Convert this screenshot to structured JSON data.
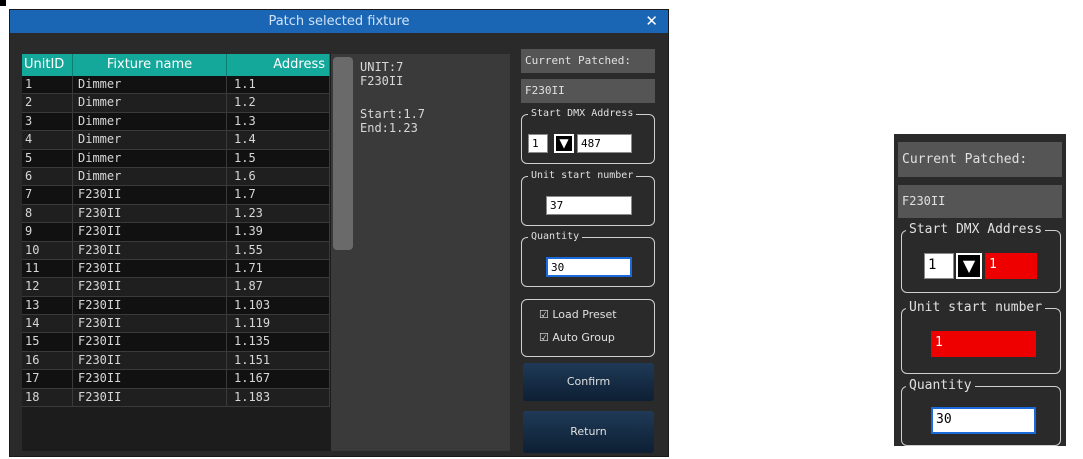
{
  "dialog": {
    "title": "Patch selected fixture",
    "close": "✕"
  },
  "table": {
    "headers": [
      "UnitID",
      "Fixture name",
      "Address"
    ],
    "rows": [
      [
        "1",
        "Dimmer",
        "1.1"
      ],
      [
        "2",
        "Dimmer",
        "1.2"
      ],
      [
        "3",
        "Dimmer",
        "1.3"
      ],
      [
        "4",
        "Dimmer",
        "1.4"
      ],
      [
        "5",
        "Dimmer",
        "1.5"
      ],
      [
        "6",
        "Dimmer",
        "1.6"
      ],
      [
        "7",
        "F230II",
        "1.7"
      ],
      [
        "8",
        "F230II",
        "1.23"
      ],
      [
        "9",
        "F230II",
        "1.39"
      ],
      [
        "10",
        "F230II",
        "1.55"
      ],
      [
        "11",
        "F230II",
        "1.71"
      ],
      [
        "12",
        "F230II",
        "1.87"
      ],
      [
        "13",
        "F230II",
        "1.103"
      ],
      [
        "14",
        "F230II",
        "1.119"
      ],
      [
        "15",
        "F230II",
        "1.135"
      ],
      [
        "16",
        "F230II",
        "1.151"
      ],
      [
        "17",
        "F230II",
        "1.167"
      ],
      [
        "18",
        "F230II",
        "1.183"
      ]
    ]
  },
  "info": {
    "unit": "UNIT:7",
    "fixture": "F230II",
    "start": "Start:1.7",
    "end": "End:1.23"
  },
  "panel": {
    "current_label": "Current Patched:",
    "current_value": "F230II",
    "dmx_title": "Start DMX Address",
    "dmx_universe": "1",
    "dmx_arrow": "▼",
    "dmx_address": "487",
    "unit_title": "Unit start number",
    "unit_value": "37",
    "qty_title": "Quantity",
    "qty_value": "30",
    "load_preset": "Load Preset",
    "auto_group": "Auto Group",
    "check_mark": "☑",
    "confirm": "Confirm",
    "return": "Return"
  },
  "zoom_panel": {
    "current_label": "Current Patched:",
    "current_value": "F230II",
    "dmx_title": "Start DMX Address",
    "dmx_universe": "1",
    "dmx_arrow": "▼",
    "dmx_address": "1",
    "unit_title": "Unit start number",
    "unit_value": "1",
    "qty_title": "Quantity",
    "qty_value": "30"
  },
  "colors": {
    "title_bar": "#1a66b5",
    "table_header": "#14a89a",
    "highlight": "#ee0000"
  }
}
